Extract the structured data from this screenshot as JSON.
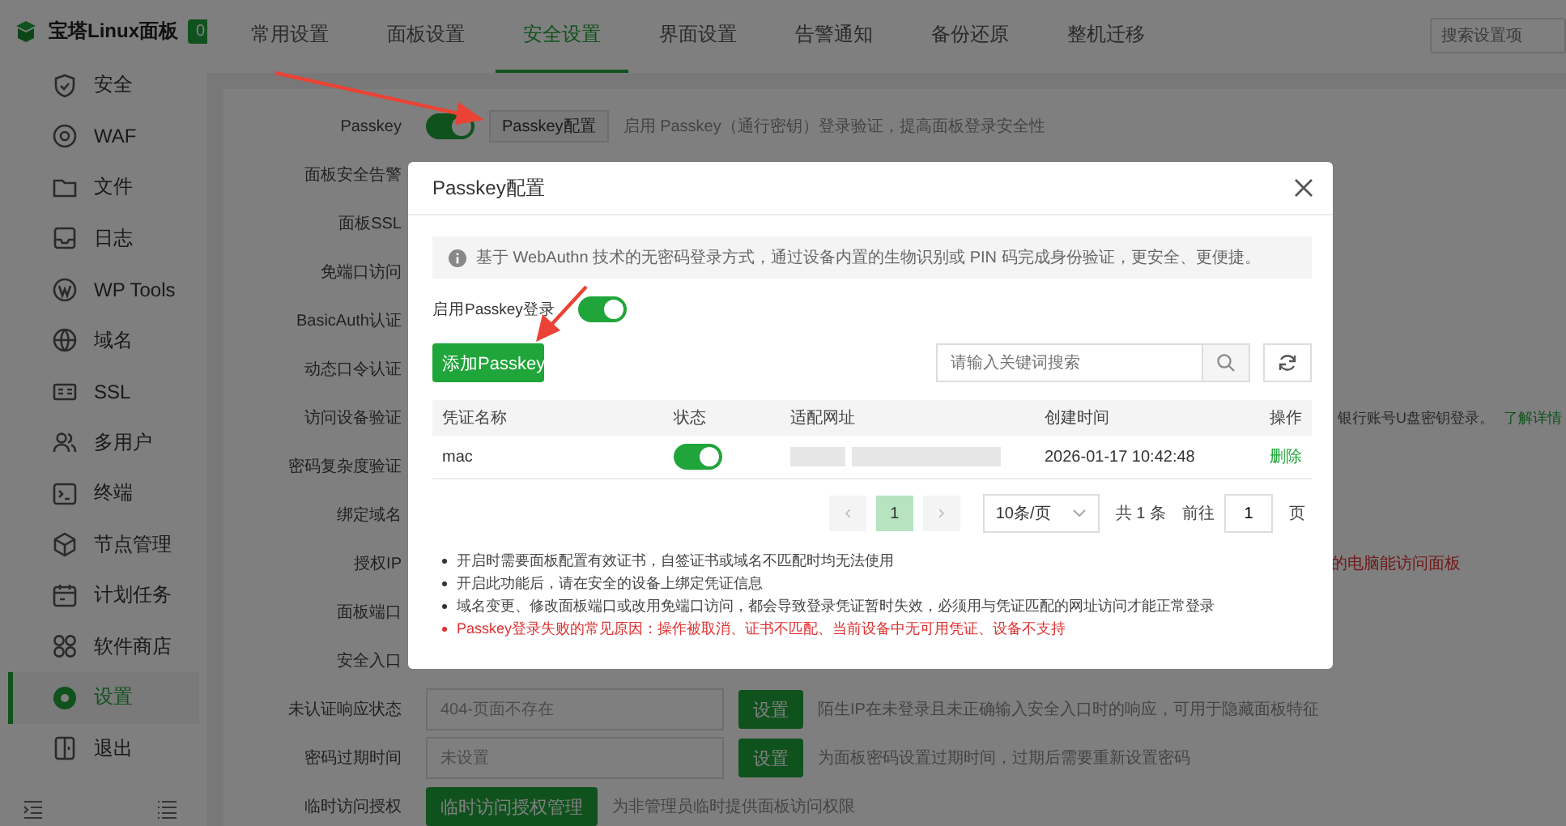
{
  "sidebar": {
    "logo": "宝塔Linux面板",
    "badge": "0",
    "items": [
      {
        "label": "安全",
        "selected": false
      },
      {
        "label": "WAF",
        "selected": false
      },
      {
        "label": "文件",
        "selected": false
      },
      {
        "label": "日志",
        "selected": false
      },
      {
        "label": "WP Tools",
        "selected": false
      },
      {
        "label": "域名",
        "selected": false
      },
      {
        "label": "SSL",
        "selected": false
      },
      {
        "label": "多用户",
        "selected": false
      },
      {
        "label": "终端",
        "selected": false
      },
      {
        "label": "节点管理",
        "selected": false
      },
      {
        "label": "计划任务",
        "selected": false
      },
      {
        "label": "软件商店",
        "selected": false
      },
      {
        "label": "设置",
        "selected": true
      },
      {
        "label": "退出",
        "selected": false
      }
    ]
  },
  "tabs": [
    {
      "label": "常用设置",
      "selected": false
    },
    {
      "label": "面板设置",
      "selected": false
    },
    {
      "label": "安全设置",
      "selected": true
    },
    {
      "label": "界面设置",
      "selected": false
    },
    {
      "label": "告警通知",
      "selected": false
    },
    {
      "label": "备份还原",
      "selected": false
    },
    {
      "label": "整机迁移",
      "selected": false
    }
  ],
  "search": {
    "placeholder": "搜索设置项"
  },
  "settings": [
    {
      "label": "Passkey",
      "kind": "passkey",
      "on": true,
      "button": "Passkey配置",
      "description": "启用 Passkey（通行密钥）登录验证，提高面板登录安全性"
    },
    {
      "label": "面板安全告警",
      "kind": "plain"
    },
    {
      "label": "面板SSL",
      "kind": "plain"
    },
    {
      "label": "免端口访问",
      "kind": "plain"
    },
    {
      "label": "BasicAuth认证",
      "kind": "plain"
    },
    {
      "label": "动态口令认证",
      "kind": "plain"
    },
    {
      "label": "访问设备验证",
      "kind": "note",
      "note": "银行账号U盘密钥登录。",
      "link": "了解详情"
    },
    {
      "label": "密码复杂度验证",
      "kind": "plain"
    },
    {
      "label": "绑定域名",
      "kind": "plain"
    },
    {
      "label": "授权IP",
      "kind": "warning",
      "note": "的电脑能访问面板"
    },
    {
      "label": "面板端口",
      "kind": "plain"
    },
    {
      "label": "安全入口",
      "kind": "plain"
    },
    {
      "label": "未认证响应状态",
      "kind": "input",
      "value": "404-页面不存在",
      "button": "设置",
      "description": "陌生IP在未登录且未正确输入安全入口时的响应，可用于隐藏面板特征"
    },
    {
      "label": "密码过期时间",
      "kind": "input",
      "value": "未设置",
      "button": "设置",
      "description": "为面板密码设置过期时间，过期后需要重新设置密码"
    },
    {
      "label": "临时访问授权",
      "kind": "action",
      "button": "临时访问授权管理",
      "description": "为非管理员临时提供面板访问权限"
    }
  ],
  "dialog": {
    "title": "Passkey配置",
    "info": "基于 WebAuthn 技术的无密码登录方式，通过设备内置的生物识别或 PIN 码完成身份验证，更安全、更便捷。",
    "enable": {
      "label": "启用Passkey登录",
      "on": true
    },
    "add_button": "添加Passkey",
    "search": {
      "placeholder": "请输入关键词搜索"
    },
    "table": {
      "columns": [
        "凭证名称",
        "状态",
        "适配网址",
        "创建时间",
        "操作"
      ],
      "rows": [
        {
          "name": "mac",
          "on": true,
          "created": "2026-01-17 10:42:48",
          "action": "删除"
        }
      ]
    },
    "pagination": {
      "pages": [
        {
          "label": "1",
          "selected": true
        }
      ],
      "page_size": "10条/页",
      "total": "共 1 条",
      "goto": "前往",
      "goto_value": "1",
      "unit": "页"
    },
    "notes": [
      {
        "text": "开启时需要面板配置有效证书，自签证书或域名不匹配时均无法使用",
        "kind": "normal"
      },
      {
        "text": "开启此功能后，请在安全的设备上绑定凭证信息",
        "kind": "normal"
      },
      {
        "text": "域名变更、修改面板端口或改用免端口访问，都会导致登录凭证暂时失效，必须用与凭证匹配的网址访问才能正常登录",
        "kind": "normal"
      },
      {
        "text": "Passkey登录失败的常见原因：操作被取消、证书不匹配、当前设备中无可用凭证、设备不支持",
        "kind": "warning"
      }
    ]
  }
}
